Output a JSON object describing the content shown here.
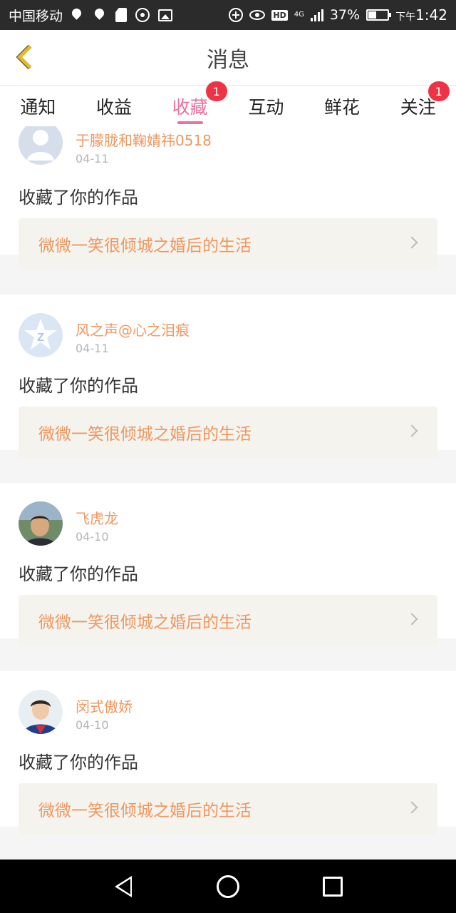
{
  "status_bar": {
    "carrier": "中国移动",
    "network_label": "4G",
    "hd_label": "HD",
    "battery": "37%",
    "time_prefix": "下午",
    "time": "1:42"
  },
  "header": {
    "title": "消息",
    "back_icon": "chevron-left-icon"
  },
  "tabs": [
    {
      "label": "通知",
      "badge": ""
    },
    {
      "label": "收益",
      "badge": ""
    },
    {
      "label": "收藏",
      "badge": "1",
      "active": true
    },
    {
      "label": "互动",
      "badge": ""
    },
    {
      "label": "鲜花",
      "badge": ""
    },
    {
      "label": "关注",
      "badge": "1"
    }
  ],
  "messages": [
    {
      "username": "于朦胧和鞠婧祎0518",
      "date": "04-11",
      "action": "收藏了你的作品",
      "work_title": "微微一笑很倾城之婚后的生活",
      "avatar": "default-avatar"
    },
    {
      "username": "风之声@心之泪痕",
      "date": "04-11",
      "action": "收藏了你的作品",
      "work_title": "微微一笑很倾城之婚后的生活",
      "avatar": "qq-avatar"
    },
    {
      "username": "飞虎龙",
      "date": "04-10",
      "action": "收藏了你的作品",
      "work_title": "微微一笑很倾城之婚后的生活",
      "avatar": "photo-avatar"
    },
    {
      "username": "闵式傲娇",
      "date": "04-10",
      "action": "收藏了你的作品",
      "work_title": "微微一笑很倾城之婚后的生活",
      "avatar": "photo-avatar"
    }
  ],
  "colors": {
    "accent_pink": "#ee6f9d",
    "username_orange": "#f0975f",
    "badge_red": "#f03344",
    "back_yellow": "#e7b62a"
  }
}
